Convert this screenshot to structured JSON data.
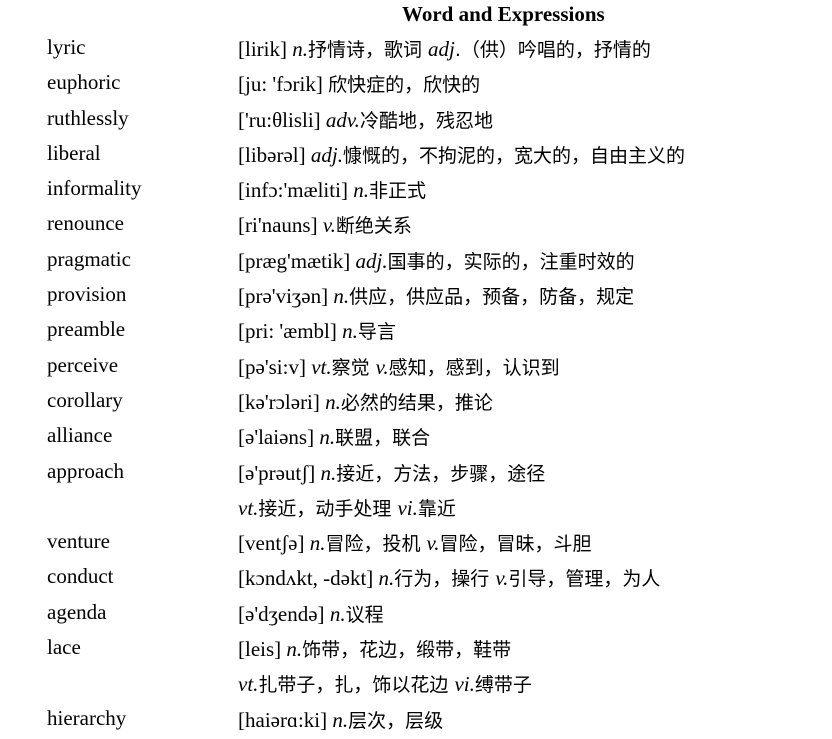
{
  "title": "Word and Expressions",
  "entries": [
    {
      "word": "lyric",
      "lines": [
        [
          {
            "t": "[lirik] "
          },
          {
            "t": "n.",
            "p": 1
          },
          {
            "t": "抒情诗，歌词 ",
            "c": 1
          },
          {
            "t": "adj",
            "p": 1
          },
          {
            "t": ".（供）吟唱的，抒情的",
            "c": 1
          }
        ]
      ]
    },
    {
      "word": "euphoric",
      "lines": [
        [
          {
            "t": "[ju: 'fɔrik] "
          },
          {
            "t": "欣快症的，欣快的",
            "c": 1
          }
        ]
      ]
    },
    {
      "word": "ruthlessly",
      "lines": [
        [
          {
            "t": "['ru:θlisli] "
          },
          {
            "t": "adv.",
            "p": 1
          },
          {
            "t": "冷酷地，残忍地",
            "c": 1
          }
        ]
      ]
    },
    {
      "word": "liberal",
      "lines": [
        [
          {
            "t": "[libərəl] "
          },
          {
            "t": "adj.",
            "p": 1
          },
          {
            "t": "慷慨的，不拘泥的，宽大的，自由主义的",
            "c": 1
          }
        ]
      ]
    },
    {
      "word": "informality",
      "lines": [
        [
          {
            "t": "[infɔ:'mæliti] "
          },
          {
            "t": "n.",
            "p": 1
          },
          {
            "t": "非正式",
            "c": 1
          }
        ]
      ]
    },
    {
      "word": "renounce",
      "lines": [
        [
          {
            "t": "[ri'nauns] "
          },
          {
            "t": "v.",
            "p": 1
          },
          {
            "t": "断绝关系",
            "c": 1
          }
        ]
      ]
    },
    {
      "word": "pragmatic",
      "lines": [
        [
          {
            "t": "[præg'mætik] "
          },
          {
            "t": "adj.",
            "p": 1
          },
          {
            "t": "国事的，实际的，注重时效的",
            "c": 1
          }
        ]
      ]
    },
    {
      "word": "provision",
      "lines": [
        [
          {
            "t": "[prə'viʒən] "
          },
          {
            "t": "n.",
            "p": 1
          },
          {
            "t": "供应，供应品，预备，防备，规定",
            "c": 1
          }
        ]
      ]
    },
    {
      "word": "preamble",
      "lines": [
        [
          {
            "t": "[pri: 'æmbl] "
          },
          {
            "t": "n.",
            "p": 1
          },
          {
            "t": "导言",
            "c": 1
          }
        ]
      ]
    },
    {
      "word": "perceive",
      "lines": [
        [
          {
            "t": "[pə'si:v] "
          },
          {
            "t": "vt.",
            "p": 1
          },
          {
            "t": "察觉 ",
            "c": 1
          },
          {
            "t": "v.",
            "p": 1
          },
          {
            "t": "感知，感到，认识到",
            "c": 1
          }
        ]
      ]
    },
    {
      "word": "corollary",
      "lines": [
        [
          {
            "t": "[kə'rɔləri] "
          },
          {
            "t": "n.",
            "p": 1
          },
          {
            "t": "必然的结果，推论",
            "c": 1
          }
        ]
      ]
    },
    {
      "word": "alliance",
      "lines": [
        [
          {
            "t": "[ə'laiəns] "
          },
          {
            "t": "n.",
            "p": 1
          },
          {
            "t": "联盟，联合",
            "c": 1
          }
        ]
      ]
    },
    {
      "word": "approach",
      "lines": [
        [
          {
            "t": "[ə'prəutʃ] "
          },
          {
            "t": "n.",
            "p": 1
          },
          {
            "t": "接近，方法，步骤，途径",
            "c": 1
          }
        ],
        [
          {
            "t": "vt.",
            "p": 1
          },
          {
            "t": "接近，动手处理 ",
            "c": 1
          },
          {
            "t": "vi.",
            "p": 1
          },
          {
            "t": "靠近",
            "c": 1
          }
        ]
      ]
    },
    {
      "word": "venture",
      "lines": [
        [
          {
            "t": "[ventʃə] "
          },
          {
            "t": "n.",
            "p": 1
          },
          {
            "t": "冒险，投机 ",
            "c": 1
          },
          {
            "t": "v.",
            "p": 1
          },
          {
            "t": "冒险，冒昧，斗胆",
            "c": 1
          }
        ]
      ]
    },
    {
      "word": "conduct",
      "lines": [
        [
          {
            "t": "[kɔndʌkt, -dəkt] "
          },
          {
            "t": "n.",
            "p": 1
          },
          {
            "t": "行为，操行 ",
            "c": 1
          },
          {
            "t": "v.",
            "p": 1
          },
          {
            "t": "引导，管理，为人",
            "c": 1
          }
        ]
      ]
    },
    {
      "word": "agenda",
      "lines": [
        [
          {
            "t": "[ə'dʒendə] "
          },
          {
            "t": "n.",
            "p": 1
          },
          {
            "t": "议程",
            "c": 1
          }
        ]
      ]
    },
    {
      "word": "lace",
      "lines": [
        [
          {
            "t": "[leis] "
          },
          {
            "t": "n.",
            "p": 1
          },
          {
            "t": "饰带，花边，缎带，鞋带",
            "c": 1
          }
        ],
        [
          {
            "t": "vt.",
            "p": 1
          },
          {
            "t": "扎带子，扎，饰以花边 ",
            "c": 1
          },
          {
            "t": "vi.",
            "p": 1
          },
          {
            "t": "缚带子",
            "c": 1
          }
        ]
      ]
    },
    {
      "word": "hierarchy",
      "lines": [
        [
          {
            "t": "[haiərɑ:ki] "
          },
          {
            "t": "n.",
            "p": 1
          },
          {
            "t": "层次，层级",
            "c": 1
          }
        ]
      ]
    }
  ]
}
